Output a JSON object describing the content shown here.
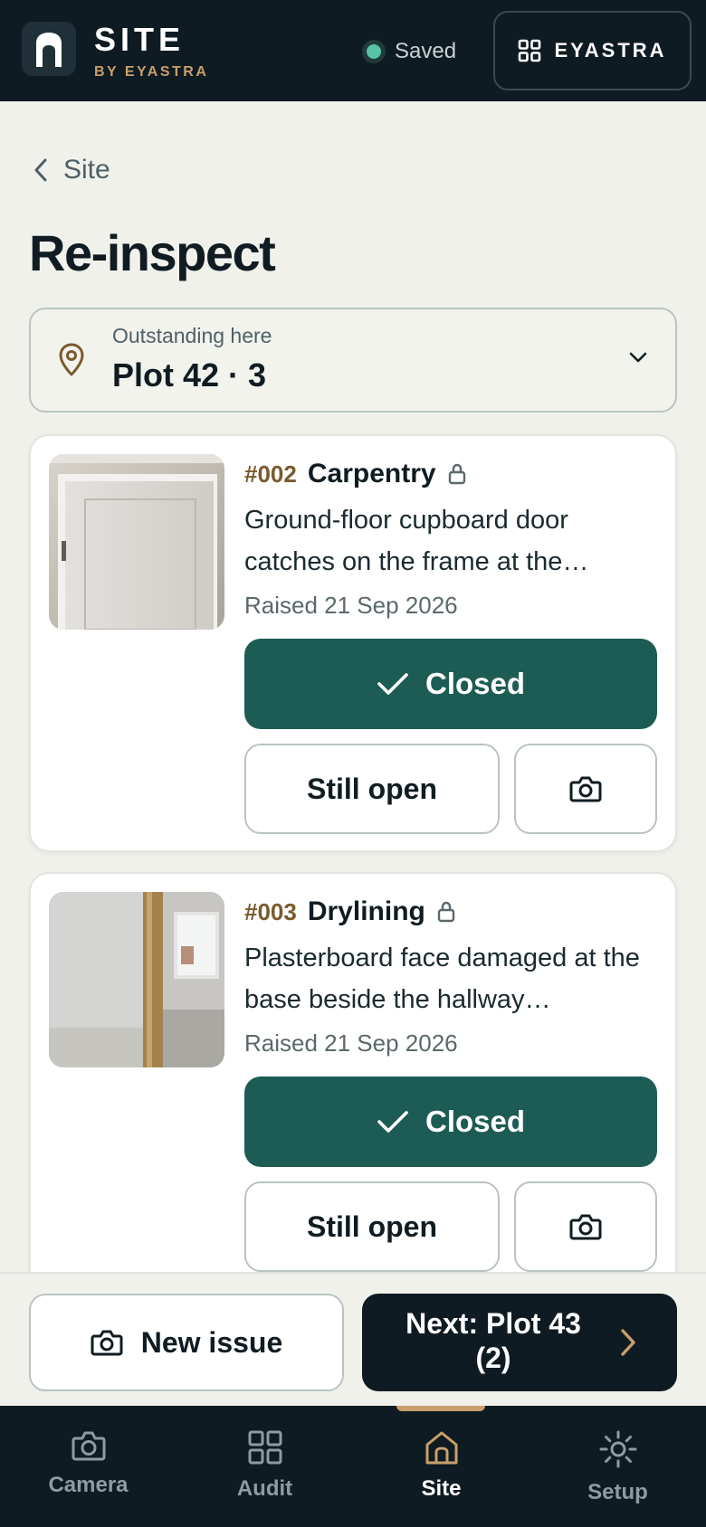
{
  "header": {
    "brand_title": "SITE",
    "brand_subtitle": "BY EYASTRA",
    "status_label": "Saved",
    "org_label": "EYASTRA"
  },
  "breadcrumb": {
    "back_label": "Site"
  },
  "page": {
    "title": "Re-inspect"
  },
  "location": {
    "caption": "Outstanding here",
    "value": "Plot 42 · 3"
  },
  "issues": [
    {
      "number": "#002",
      "trade": "Carpentry",
      "description": "Ground-floor cupboard door catches on the frame at the…",
      "raised": "Raised 21 Sep 2026",
      "closed_label": "Closed",
      "open_label": "Still open",
      "locked": true
    },
    {
      "number": "#003",
      "trade": "Drylining",
      "description": "Plasterboard face damaged at the base beside the hallway…",
      "raised": "Raised 21 Sep 2026",
      "closed_label": "Closed",
      "open_label": "Still open",
      "locked": true
    }
  ],
  "actions": {
    "new_issue_label": "New issue",
    "next_label": "Next: Plot 43 (2)"
  },
  "nav": {
    "items": [
      {
        "label": "Camera",
        "icon": "camera-icon"
      },
      {
        "label": "Audit",
        "icon": "grid-icon"
      },
      {
        "label": "Site",
        "icon": "house-icon"
      },
      {
        "label": "Setup",
        "icon": "gear-icon"
      }
    ],
    "active": "Site"
  },
  "colors": {
    "header_bg": "#0f1b22",
    "accent_green": "#1d5c54",
    "accent_gold": "#c7a06b",
    "status_dot": "#58c4a6",
    "page_bg": "#f1f1ec"
  }
}
